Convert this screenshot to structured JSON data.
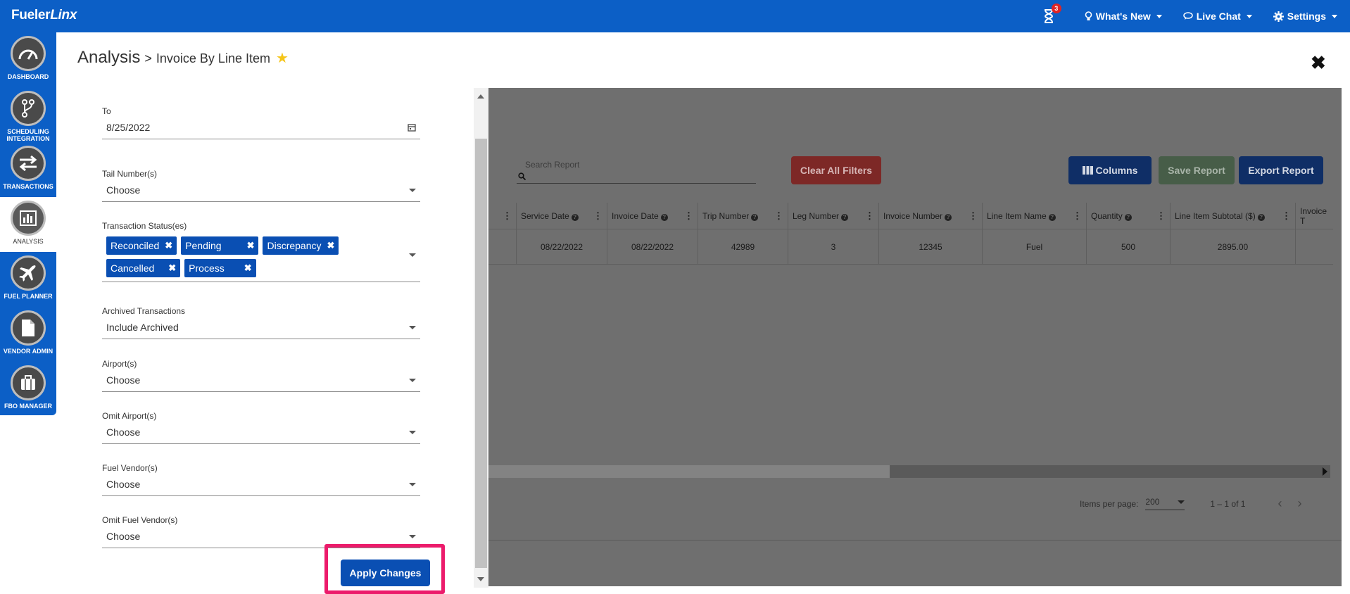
{
  "app": {
    "brand_main": "Fueler",
    "brand_italic": "Linx"
  },
  "topnav": {
    "notification_count": "3",
    "whats_new": "What's New",
    "live_chat": "Live Chat",
    "settings": "Settings"
  },
  "sidebar": {
    "items": [
      {
        "label": "DASHBOARD",
        "icon": "dashboard-gauge-icon"
      },
      {
        "label": "SCHEDULING INTEGRATION",
        "icon": "branch-icon"
      },
      {
        "label": "TRANSACTIONS",
        "icon": "swap-arrows-icon"
      },
      {
        "label": "ANALYSIS",
        "icon": "bar-chart-icon",
        "active": true
      },
      {
        "label": "FUEL PLANNER",
        "icon": "airplane-icon"
      },
      {
        "label": "VENDOR ADMIN",
        "icon": "document-icon"
      },
      {
        "label": "FBO MANAGER",
        "icon": "briefcase-icon"
      }
    ]
  },
  "header": {
    "section": "Analysis",
    "separator": ">",
    "page": "Invoice By Line Item",
    "favorite_color": "#f5c518"
  },
  "filters": {
    "to": {
      "label": "To",
      "value": "8/25/2022"
    },
    "tail_numbers": {
      "label": "Tail Number(s)",
      "value": "Choose"
    },
    "transaction_status": {
      "label": "Transaction Status(es)",
      "chips": [
        "Reconciled",
        "Pending",
        "Discrepancy",
        "Cancelled",
        "Process"
      ]
    },
    "archived": {
      "label": "Archived Transactions",
      "value": "Include Archived"
    },
    "airports": {
      "label": "Airport(s)",
      "value": "Choose"
    },
    "omit_airports": {
      "label": "Omit Airport(s)",
      "value": "Choose"
    },
    "fuel_vendors": {
      "label": "Fuel Vendor(s)",
      "value": "Choose"
    },
    "omit_fuel_vendors": {
      "label": "Omit Fuel Vendor(s)",
      "value": "Choose"
    },
    "apply_label": "Apply Changes"
  },
  "report": {
    "search_placeholder": "Search Report",
    "clear_filters": "Clear All Filters",
    "columns": "Columns",
    "save": "Save Report",
    "export": "Export Report",
    "headers": [
      "",
      "Service Date",
      "Invoice Date",
      "Trip Number",
      "Leg Number",
      "Invoice Number",
      "Line Item Name",
      "Quantity",
      "Line Item Subtotal ($)",
      "Invoice T"
    ],
    "row": [
      "",
      "08/22/2022",
      "08/22/2022",
      "42989",
      "3",
      "12345",
      "Fuel",
      "500",
      "2895.00",
      ""
    ],
    "pager": {
      "items_per_page_label": "Items per page:",
      "items_per_page": "200",
      "range": "1 – 1 of 1"
    }
  }
}
